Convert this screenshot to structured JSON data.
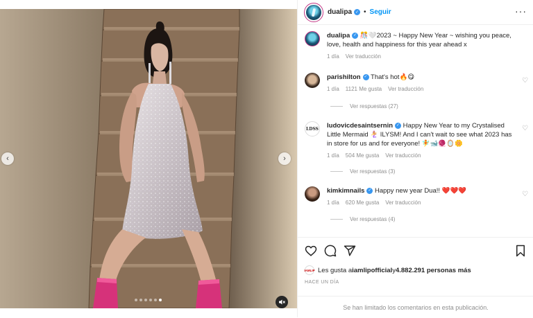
{
  "post": {
    "media": {
      "prev_symbol": "‹",
      "next_symbol": "›",
      "slide_count": 6,
      "active_slide": 5
    },
    "header": {
      "username": "dualipa",
      "separator": "•",
      "follow_label": "Seguir",
      "more_symbol": "···"
    },
    "caption": {
      "username": "dualipa",
      "text": "🎊🤍2023 ~ Happy New Year ~ wishing you peace, love, health and happiness for this year ahead x",
      "time": "1 día",
      "translate": "Ver traducción"
    },
    "comments": [
      {
        "username": "parishilton",
        "text": "That's hot🔥😋",
        "time": "1 día",
        "likes": "1121 Me gusta",
        "translate": "Ver traducción",
        "replies": "Ver respuestas (27)"
      },
      {
        "username": "ludovicdesaintsernin",
        "avatar_text": "LDSS",
        "text": "Happy New Year to my Crystalised Little Mermaid 🧜‍♀️ ILYSM! And I can't wait to see what 2023 has in store for us and for everyone! 🧚🐋🧶🪞🌼",
        "time": "1 día",
        "likes": "504 Me gusta",
        "translate": "Ver traducción",
        "replies": "Ver respuestas (3)"
      },
      {
        "username": "kimkimnails",
        "text": "Happy new year Dua!! ❤️❤️❤️",
        "time": "1 día",
        "likes": "620 Me gusta",
        "translate": "Ver traducción",
        "replies": "Ver respuestas (4)"
      }
    ],
    "likes": {
      "avatar_text": "IAMLIP",
      "prefix": "Les gusta a ",
      "user": "iamlipofficial",
      "middle": " y ",
      "count": "4.882.291 personas más"
    },
    "date": "HACE UN DÍA",
    "comments_limited": "Se han limitado los comentarios en esta publicación."
  },
  "colors": {
    "accent": "#0095f6",
    "verified": "#3897f0",
    "muted": "#8e8e8e",
    "text": "#262626"
  }
}
